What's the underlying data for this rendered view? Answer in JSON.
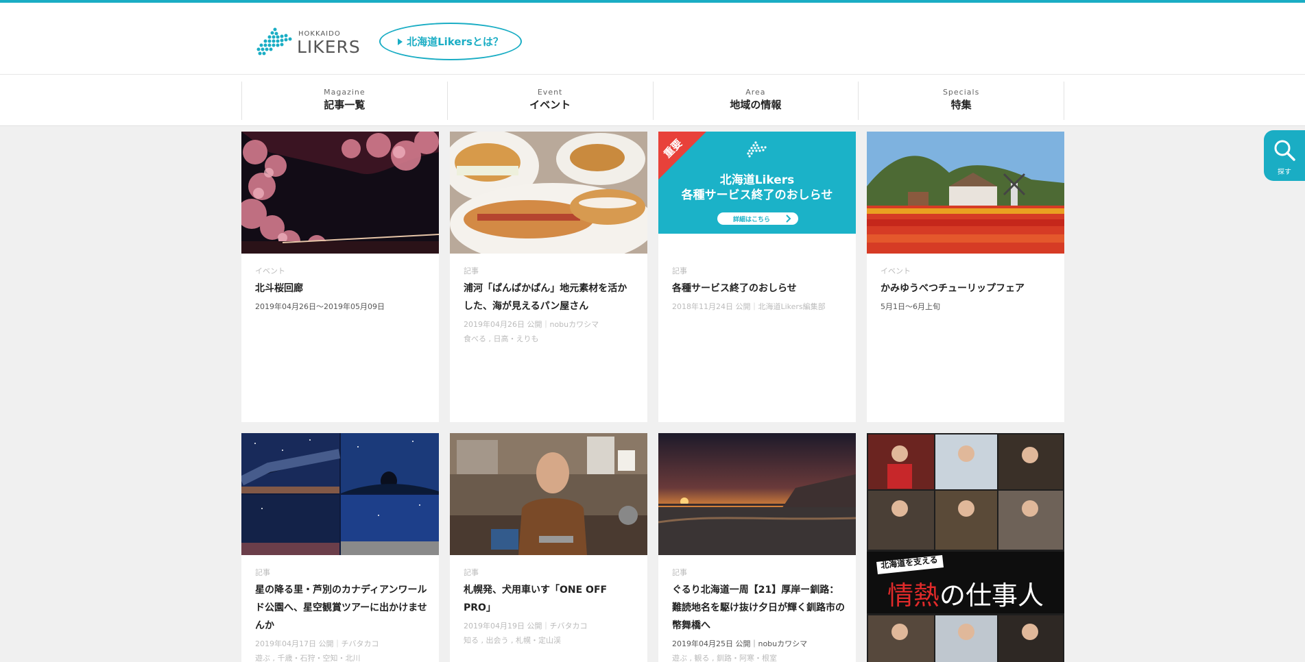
{
  "colors": {
    "accent": "#1aadc4",
    "important_badge": "#e8413a"
  },
  "header": {
    "logo_small": "HOKKAIDO",
    "logo_big": "LIKERS",
    "about_link": "北海道Likersとは？"
  },
  "nav": [
    {
      "en": "Magazine",
      "jp": "記事一覧"
    },
    {
      "en": "Event",
      "jp": "イベント"
    },
    {
      "en": "Area",
      "jp": "地域の情報"
    },
    {
      "en": "Specials",
      "jp": "特集"
    }
  ],
  "search": {
    "label": "探す",
    "icon": "search-icon"
  },
  "cards": [
    {
      "category": "イベント",
      "title": "北斗桜回廊",
      "date": "2019年04月26日〜2019年05月09日",
      "tags": "",
      "image": "cherry-blossom-night"
    },
    {
      "category": "記事",
      "title": "浦河「ぱんぱかぱん」地元素材を活かした、海が見えるパン屋さん",
      "date": "2019年04月26日 公開｜nobuカワシマ",
      "tags": "食べる , 日高・えりも",
      "image": "bread-plates"
    },
    {
      "category": "記事",
      "title": "各種サービス終了のおしらせ",
      "date": "2018年11月24日 公開｜北海道Likers編集部",
      "tags": "",
      "image": "notice-banner",
      "banner": {
        "badge": "重要",
        "line1": "北海道Likers",
        "line2": "各種サービス終了のおしらせ",
        "button": "詳細はこちら"
      }
    },
    {
      "category": "イベント",
      "title": "かみゆうべつチューリップフェア",
      "date": "5月1日〜6月上旬",
      "tags": "",
      "image": "tulip-field"
    },
    {
      "category": "記事",
      "title": "星の降る里・芦別のカナディアンワールド公園へ、星空観賞ツアーに出かけませんか",
      "date": "2019年04月17日 公開｜チバタカコ",
      "tags": "遊ぶ , 千歳・石狩・空知・北川",
      "image": "starry-sky-grid"
    },
    {
      "category": "記事",
      "title": "札幌発、犬用車いす「ONE OFF PRO」",
      "date": "2019年04月19日 公開｜チバタカコ",
      "tags": "知る , 出会う , 札幌・定山渓",
      "image": "workshop-man"
    },
    {
      "category": "記事",
      "title": "ぐるり北海道一周【21】厚岸ー釧路：難読地名を駆け抜け夕日が輝く釧路市の幣舞橋へ",
      "date": "2019年04月25日 公開｜nobuカワシマ",
      "tags": "遊ぶ , 観る , 釧路・阿寒・根室",
      "image": "sunset-harbor"
    },
    {
      "category": "",
      "title": "",
      "date": "",
      "tags": "",
      "image": "passion-workers-banner",
      "banner": {
        "tagline": "北海道を支える",
        "main_red": "情熱",
        "main_rest": "の仕事人"
      }
    }
  ]
}
